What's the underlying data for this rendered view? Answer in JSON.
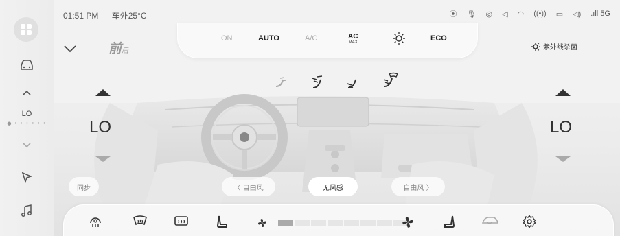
{
  "status_bar": {
    "time": "01:51 PM",
    "outside_temp": "车外25°C",
    "signal": "5G",
    "right_icons": [
      "vibrate-icon",
      "mic-icon",
      "location-pin-icon",
      "navigation-icon",
      "wifi-icon",
      "hotspot-icon",
      "screen-icon",
      "volume-icon"
    ]
  },
  "left_rail": {
    "home_icon": "app-grid-icon",
    "car_icon": "car-icon",
    "temp_value": "LO",
    "nav_icon": "navigation-icon",
    "music_icon": "music-icon"
  },
  "top_controls": {
    "on_label": "ON",
    "auto_label": "AUTO",
    "ac_label": "A/C",
    "ac_max_label": "AC",
    "ac_max_sub": "MAX",
    "sun_icon": "sun-icon",
    "eco_label": "ECO",
    "front_label": "前",
    "rear_label": "后",
    "uv_label": "紫外线杀菌"
  },
  "airflow_modes": [
    "face-airflow-icon",
    "face-feet-airflow-icon",
    "feet-airflow-icon",
    "feet-windshield-airflow-icon"
  ],
  "left_zone": {
    "temp": "LO"
  },
  "right_zone": {
    "temp": "LO"
  },
  "buttons": {
    "sync": "同步",
    "left_free": "自由风",
    "no_wind": "无风感",
    "right_free": "自由风"
  },
  "fan_level": {
    "value": 1,
    "max": 8
  },
  "dock_icons": [
    "steering-wheel-heat-icon",
    "front-defrost-icon",
    "rear-defrost-icon",
    "seat-heat-left-icon",
    "fan-low-icon",
    "fan-high-icon",
    "seat-heat-right-icon",
    "car-recirculation-icon",
    "settings-icon"
  ]
}
